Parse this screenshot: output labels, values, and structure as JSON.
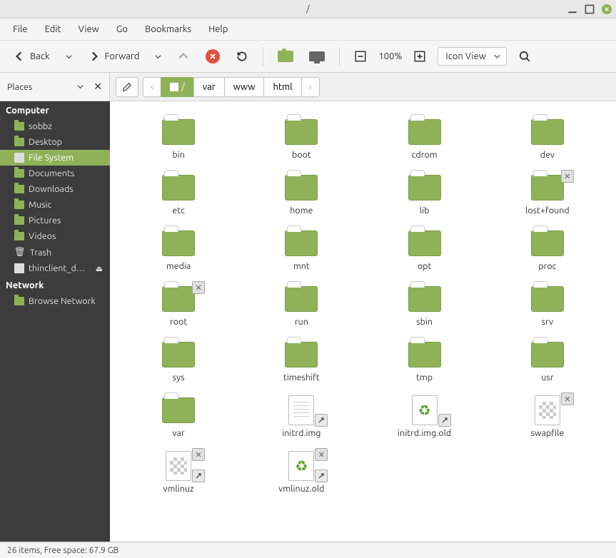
{
  "window": {
    "title": "/"
  },
  "menus": [
    "File",
    "Edit",
    "View",
    "Go",
    "Bookmarks",
    "Help"
  ],
  "toolbar": {
    "back": "Back",
    "forward": "Forward",
    "zoom": "100%",
    "view_mode": "Icon View"
  },
  "sidebar": {
    "header": "Places",
    "computer_label": "Computer",
    "network_label": "Network",
    "computer": [
      {
        "label": "sobbz",
        "type": "folder"
      },
      {
        "label": "Desktop",
        "type": "folder"
      },
      {
        "label": "File System",
        "type": "disk",
        "active": true
      },
      {
        "label": "Documents",
        "type": "folder"
      },
      {
        "label": "Downloads",
        "type": "folder"
      },
      {
        "label": "Music",
        "type": "folder"
      },
      {
        "label": "Pictures",
        "type": "folder"
      },
      {
        "label": "Videos",
        "type": "folder"
      },
      {
        "label": "Trash",
        "type": "trash"
      },
      {
        "label": "thinclient_d…",
        "type": "disk",
        "eject": true
      }
    ],
    "network": [
      {
        "label": "Browse Network",
        "type": "folder"
      }
    ]
  },
  "breadcrumbs": [
    {
      "label": "/",
      "active": true,
      "icon": "disk"
    },
    {
      "label": "var"
    },
    {
      "label": "www"
    },
    {
      "label": "html"
    }
  ],
  "items": [
    {
      "name": "bin",
      "kind": "folder"
    },
    {
      "name": "boot",
      "kind": "folder"
    },
    {
      "name": "cdrom",
      "kind": "folder"
    },
    {
      "name": "dev",
      "kind": "folder"
    },
    {
      "name": "etc",
      "kind": "folder"
    },
    {
      "name": "home",
      "kind": "folder"
    },
    {
      "name": "lib",
      "kind": "folder"
    },
    {
      "name": "lost+found",
      "kind": "folder",
      "locked": true
    },
    {
      "name": "media",
      "kind": "folder"
    },
    {
      "name": "mnt",
      "kind": "folder"
    },
    {
      "name": "opt",
      "kind": "folder"
    },
    {
      "name": "proc",
      "kind": "folder"
    },
    {
      "name": "root",
      "kind": "folder",
      "locked": true
    },
    {
      "name": "run",
      "kind": "folder"
    },
    {
      "name": "sbin",
      "kind": "folder"
    },
    {
      "name": "srv",
      "kind": "folder"
    },
    {
      "name": "sys",
      "kind": "folder"
    },
    {
      "name": "timeshift",
      "kind": "folder"
    },
    {
      "name": "tmp",
      "kind": "folder"
    },
    {
      "name": "usr",
      "kind": "folder"
    },
    {
      "name": "var",
      "kind": "folder"
    },
    {
      "name": "initrd.img",
      "kind": "textfile",
      "link": true
    },
    {
      "name": "initrd.img.old",
      "kind": "recycle",
      "link": true
    },
    {
      "name": "swapfile",
      "kind": "checker",
      "locked": true
    },
    {
      "name": "vmlinuz",
      "kind": "checker",
      "locked": true,
      "link": true
    },
    {
      "name": "vmlinuz.old",
      "kind": "recycle",
      "locked": true,
      "link": true
    }
  ],
  "status": "26 items, Free space: 67.9 GB"
}
